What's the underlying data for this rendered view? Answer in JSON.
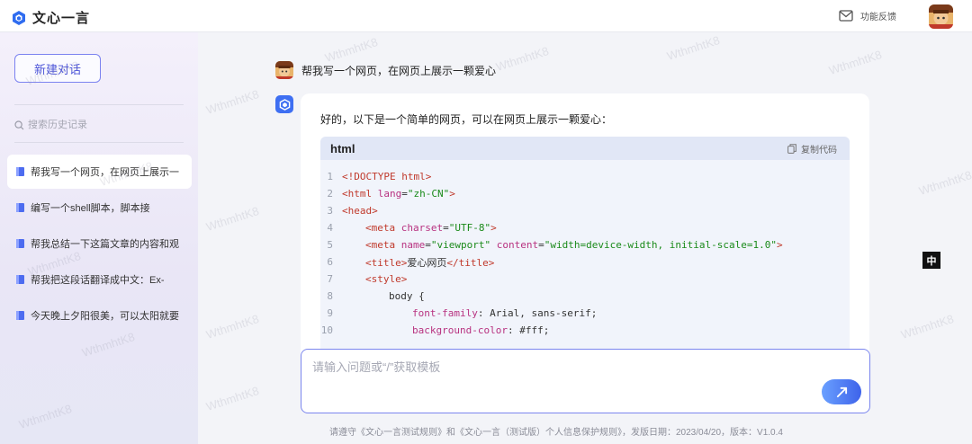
{
  "header": {
    "logo_text": "文心一言",
    "feedback_label": "功能反馈"
  },
  "sidebar": {
    "new_chat_label": "新建对话",
    "search_placeholder": "搜索历史记录",
    "history": [
      {
        "label": "帮我写一个网页，在网页上展示一",
        "active": true
      },
      {
        "label": "编写一个shell脚本，脚本接",
        "active": false
      },
      {
        "label": "帮我总结一下这篇文章的内容和观",
        "active": false
      },
      {
        "label": "帮我把这段话翻译成中文：Ex-",
        "active": false
      },
      {
        "label": "今天晚上夕阳很美，可以太阳就要",
        "active": false
      }
    ]
  },
  "conversation": {
    "user_message": "帮我写一个网页，在网页上展示一颗爱心",
    "answer_intro": "好的，以下是一个简单的网页，可以在网页上展示一颗爱心：",
    "code": {
      "language": "html",
      "copy_label": "复制代码",
      "lines": [
        {
          "n": "1",
          "indent": 0,
          "tokens": [
            {
              "t": "tag",
              "v": "<!DOCTYPE html>"
            }
          ]
        },
        {
          "n": "2",
          "indent": 0,
          "tokens": [
            {
              "t": "tag",
              "v": "<html "
            },
            {
              "t": "attr",
              "v": "lang"
            },
            {
              "t": "plain",
              "v": "="
            },
            {
              "t": "str",
              "v": "\"zh-CN\""
            },
            {
              "t": "tag",
              "v": ">"
            }
          ]
        },
        {
          "n": "3",
          "indent": 0,
          "tokens": [
            {
              "t": "tag",
              "v": "<head>"
            }
          ]
        },
        {
          "n": "4",
          "indent": 1,
          "tokens": [
            {
              "t": "tag",
              "v": "<meta "
            },
            {
              "t": "attr",
              "v": "charset"
            },
            {
              "t": "plain",
              "v": "="
            },
            {
              "t": "str",
              "v": "\"UTF-8\""
            },
            {
              "t": "tag",
              "v": ">"
            }
          ]
        },
        {
          "n": "5",
          "indent": 1,
          "tokens": [
            {
              "t": "tag",
              "v": "<meta "
            },
            {
              "t": "attr",
              "v": "name"
            },
            {
              "t": "plain",
              "v": "="
            },
            {
              "t": "str",
              "v": "\"viewport\""
            },
            {
              "t": "plain",
              "v": " "
            },
            {
              "t": "attr",
              "v": "content"
            },
            {
              "t": "plain",
              "v": "="
            },
            {
              "t": "str",
              "v": "\"width=device-width, initial-scale=1.0\""
            },
            {
              "t": "tag",
              "v": ">"
            }
          ]
        },
        {
          "n": "6",
          "indent": 1,
          "tokens": [
            {
              "t": "tag",
              "v": "<title>"
            },
            {
              "t": "plain",
              "v": "爱心网页"
            },
            {
              "t": "tag",
              "v": "</title>"
            }
          ]
        },
        {
          "n": "7",
          "indent": 1,
          "tokens": [
            {
              "t": "tag",
              "v": "<style>"
            }
          ]
        },
        {
          "n": "8",
          "indent": 2,
          "tokens": [
            {
              "t": "plain",
              "v": "body {"
            }
          ]
        },
        {
          "n": "9",
          "indent": 3,
          "tokens": [
            {
              "t": "prop",
              "v": "font-family"
            },
            {
              "t": "plain",
              "v": ": Arial, sans-serif;"
            }
          ]
        },
        {
          "n": "10",
          "indent": 3,
          "tokens": [
            {
              "t": "prop",
              "v": "background-color"
            },
            {
              "t": "plain",
              "v": ": #fff;"
            }
          ]
        }
      ]
    }
  },
  "composer": {
    "placeholder": "请输入问题或“/”获取模板",
    "footer_note": "请遵守《文心一言测试规则》和《文心一言（测试版）个人信息保护规则》，发版日期：2023/04/20，版本：V1.0.4"
  },
  "ime_indicator": "中",
  "watermark_text": "WthmhtK8",
  "colors": {
    "accent": "#4d55d8",
    "tag": "#c0392b",
    "string": "#1a8a1a",
    "attr": "#b83280"
  }
}
